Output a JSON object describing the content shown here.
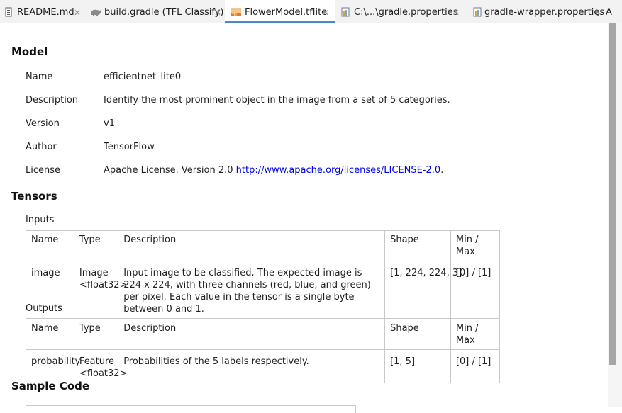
{
  "tabs": [
    {
      "label": "README.md",
      "icon": "markdown-file-icon",
      "closable": true,
      "active": false
    },
    {
      "label": "build.gradle (TFL Classify)",
      "icon": "gradle-elephant-icon",
      "closable": true,
      "active": false
    },
    {
      "label": "FlowerModel.tflite",
      "icon": "tflite-file-icon",
      "closable": true,
      "active": true
    },
    {
      "label": "C:\\...\\gradle.properties",
      "icon": "properties-file-icon",
      "closable": true,
      "active": false
    },
    {
      "label": "gradle-wrapper.properties",
      "icon": "properties-file-icon",
      "closable": false,
      "active": false
    }
  ],
  "tab_overflow_label": "A",
  "model": {
    "heading": "Model",
    "rows": [
      {
        "key": "Name",
        "value": "efficientnet_lite0"
      },
      {
        "key": "Description",
        "value": "Identify the most prominent object in the image from a set of 5 categories."
      },
      {
        "key": "Version",
        "value": "v1"
      },
      {
        "key": "Author",
        "value": "TensorFlow"
      },
      {
        "key": "License",
        "value": "Apache License. Version 2.0 ",
        "link": "http://www.apache.org/licenses/LICENSE-2.0",
        "suffix": "."
      }
    ]
  },
  "tensors": {
    "heading": "Tensors",
    "columns": [
      "Name",
      "Type",
      "Description",
      "Shape",
      "Min / Max"
    ],
    "inputs": {
      "label": "Inputs",
      "rows": [
        {
          "name": "image",
          "type": "Image\n<float32>",
          "description": "Input image to be classified. The expected image is 224 x 224, with three channels (red, blue, and green) per pixel. Each value in the tensor is a single byte between 0 and 1.",
          "shape": "[1, 224, 224, 3]",
          "minmax": "[0] / [1]"
        }
      ]
    },
    "outputs": {
      "label": "Outputs",
      "rows": [
        {
          "name": "probability",
          "type": "Feature\n<float32>",
          "description": "Probabilities of the 5 labels respectively.",
          "shape": "[1, 5]",
          "minmax": "[0] / [1]"
        }
      ]
    }
  },
  "sample_code": {
    "heading": "Sample Code"
  }
}
